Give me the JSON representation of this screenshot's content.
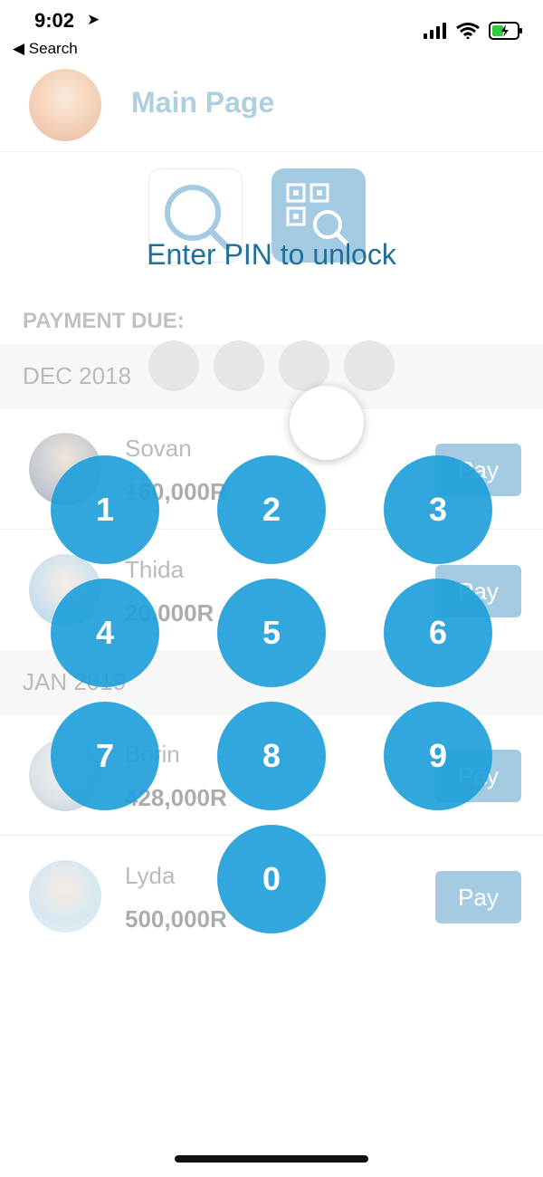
{
  "status_bar": {
    "time": "9:02",
    "location_glyph": "➤",
    "back_label": "◀ Search"
  },
  "header": {
    "title": "Main Page"
  },
  "icons": {
    "search": "search-icon",
    "qr_search": "qr-search-icon"
  },
  "payment": {
    "section_label": "PAYMENT DUE:",
    "months": [
      {
        "label": "DEC 2018",
        "rows": [
          {
            "name": "Sovan",
            "amount": "160,000R",
            "pay_label": "Pay"
          },
          {
            "name": "Thida",
            "amount": "20,000R",
            "pay_label": "Pay"
          }
        ]
      },
      {
        "label": "JAN 2019",
        "rows": [
          {
            "name": "Borin",
            "amount": "428,000R",
            "pay_label": "Pay"
          },
          {
            "name": "Lyda",
            "amount": "500,000R",
            "pay_label": "Pay"
          }
        ]
      }
    ]
  },
  "lock": {
    "title": "Enter PIN to unlock",
    "keys": [
      "1",
      "2",
      "3",
      "4",
      "5",
      "6",
      "7",
      "8",
      "9",
      "0"
    ]
  },
  "colors": {
    "accent": "#1fa0da",
    "brand": "#1d7fb8",
    "title_text": "#1f6f99"
  }
}
